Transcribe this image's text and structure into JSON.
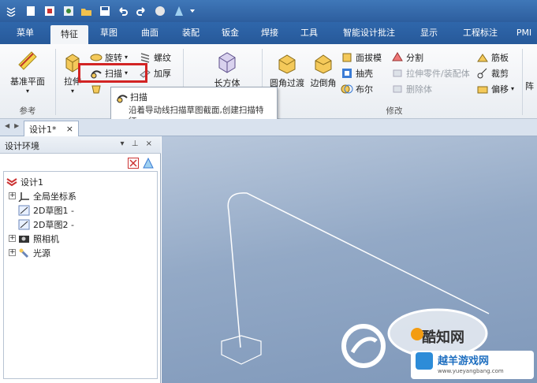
{
  "qat": {
    "icons": [
      "app-menu-icon",
      "new-doc-icon",
      "save-as-icon",
      "export-icon",
      "open-folder-icon",
      "save-icon",
      "undo-icon",
      "redo-icon",
      "render-icon",
      "fill-icon",
      "qat-dropdown-icon"
    ]
  },
  "tabs": [
    "菜单",
    "特征",
    "草图",
    "曲面",
    "装配",
    "钣金",
    "焊接",
    "工具",
    "智能设计批注",
    "显示",
    "工程标注",
    "PMI"
  ],
  "active_tab": "特征",
  "ribbon": {
    "datum_plane": "基准平面",
    "group_reference": "参考",
    "extrude": "拉伸",
    "revolve": "旋转",
    "sweep": "扫描",
    "thread": "螺纹",
    "thicken": "加厚",
    "box": "长方体",
    "fillet": "圆角过渡",
    "chamfer": "边倒角",
    "draft": "面拔模",
    "shell": "抽壳",
    "boolean": "布尔",
    "split": "分割",
    "stretch": "拉伸零件/装配体",
    "delete_body": "删除体",
    "rib": "筋板",
    "trim": "裁剪",
    "offset": "偏移",
    "group_modify": "修改",
    "more": "阵"
  },
  "tooltip": {
    "title": "扫描",
    "text": "沿着导动线扫描草图截面,创建扫描特征."
  },
  "doc_tab": {
    "label": "设计1*",
    "close": "×"
  },
  "panel": {
    "title": "设计环境",
    "pin": "▾ ⊥ ×",
    "tree": [
      {
        "label": "设计1",
        "icon": "design-root-icon"
      },
      {
        "label": "全局坐标系",
        "icon": "coordinate-system-icon"
      },
      {
        "label": "2D草图1 -",
        "icon": "sketch-icon"
      },
      {
        "label": "2D草图2 -",
        "icon": "sketch-icon"
      },
      {
        "label": "照相机",
        "icon": "camera-icon"
      },
      {
        "label": "光源",
        "icon": "light-icon"
      }
    ]
  },
  "watermark": {
    "brand": "酷知网",
    "site_cn": "越羊游戏网",
    "site_url": "www.yueyangbang.com"
  }
}
